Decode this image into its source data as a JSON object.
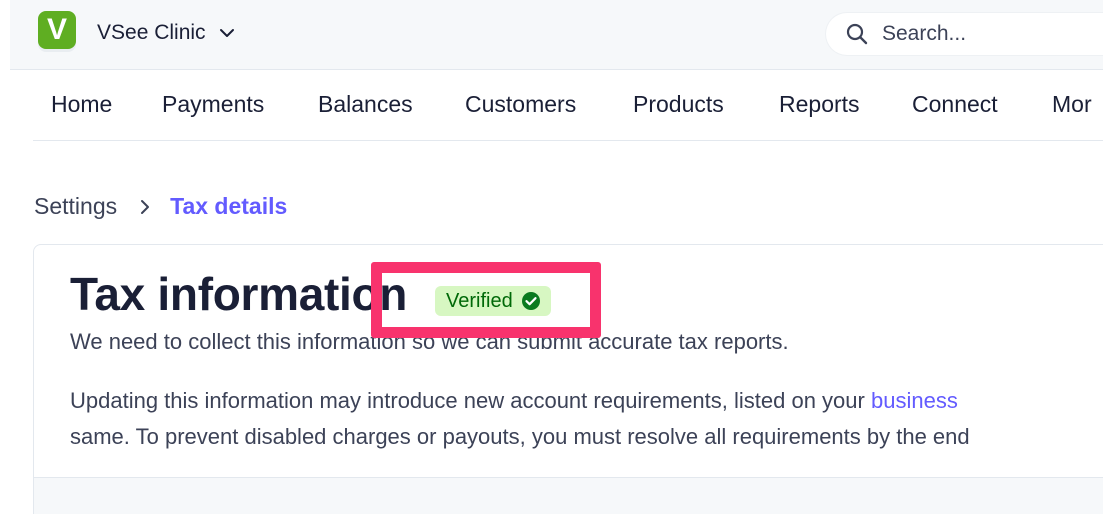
{
  "header": {
    "logo_letter": "V",
    "account_name": "VSee Clinic",
    "search": {
      "placeholder": "Search..."
    }
  },
  "nav": {
    "items": [
      {
        "label": "Home"
      },
      {
        "label": "Payments"
      },
      {
        "label": "Balances"
      },
      {
        "label": "Customers"
      },
      {
        "label": "Products"
      },
      {
        "label": "Reports"
      },
      {
        "label": "Connect"
      },
      {
        "label": "Mor"
      }
    ]
  },
  "breadcrumb": {
    "parent": "Settings",
    "current": "Tax details"
  },
  "card": {
    "title": "Tax information",
    "status_badge": "Verified",
    "intro": "We need to collect this information so we can submit accurate tax reports.",
    "notice_line1_prefix": "Updating this information may introduce new account requirements, listed on your ",
    "notice_link": "business",
    "notice_line2": "same. To prevent disabled charges or payouts, you must resolve all requirements by the end"
  },
  "colors": {
    "accent": "#635bff",
    "logo_green": "#5fae22",
    "badge_bg": "#d7f7c2",
    "badge_text": "#006908",
    "highlight": "#f8336d"
  },
  "icons": [
    "chevron-down-icon",
    "search-icon",
    "chevron-right-icon",
    "check-circle-icon"
  ]
}
